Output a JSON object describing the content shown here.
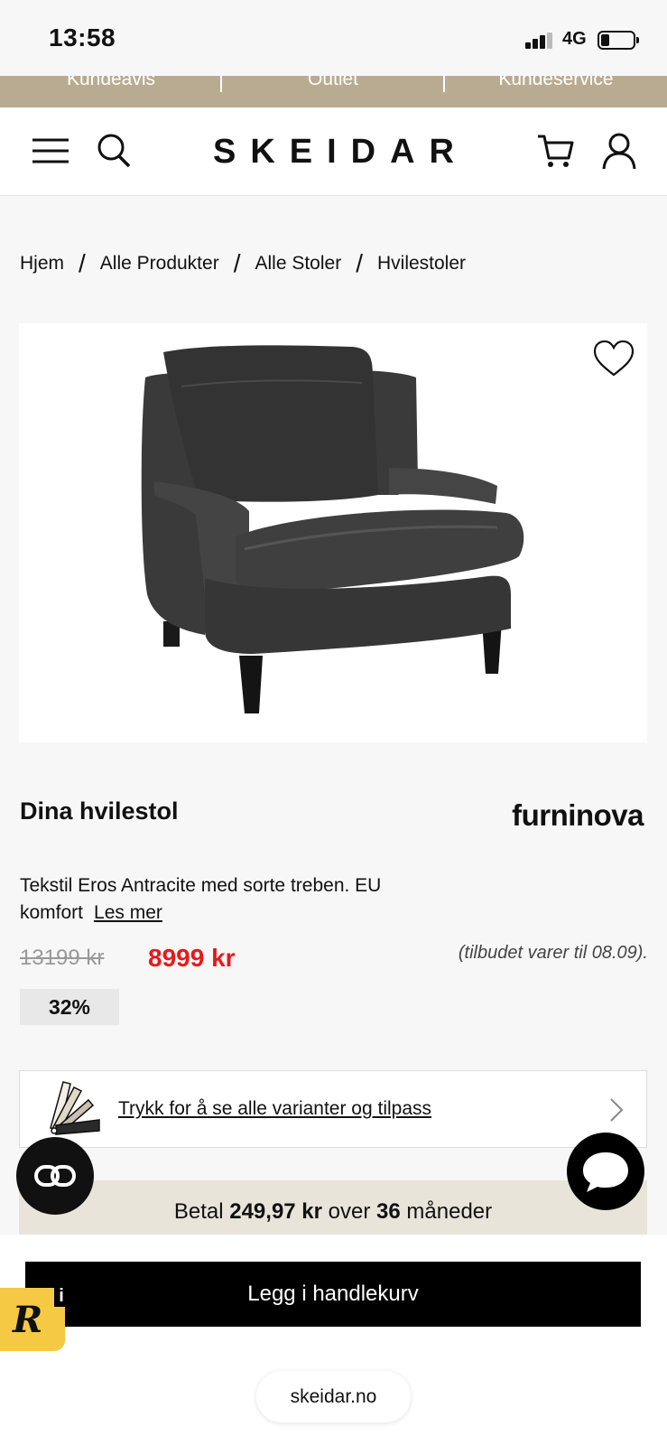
{
  "status": {
    "time": "13:58",
    "network": "4G"
  },
  "topbar": {
    "items": [
      "Kundeavis",
      "Outlet",
      "Kundeservice"
    ]
  },
  "header": {
    "logo": "SKEIDAR",
    "icons": [
      "menu-icon",
      "search-icon",
      "cart-icon",
      "user-icon"
    ]
  },
  "breadcrumb": [
    "Hjem",
    "Alle Produkter",
    "Alle Stoler",
    "Hvilestoler"
  ],
  "product": {
    "title": "Dina hvilestol",
    "brand": "furninova",
    "description": "Tekstil Eros Antracite med sorte treben. EU komfort",
    "read_more": "Les mer",
    "old_price": "13199 kr",
    "new_price": "8999 kr",
    "offer_note": "(tilbudet varer til 08.09).",
    "discount": "32%",
    "variants_label": "Trykk for å se alle varianter og tilpass"
  },
  "payment": {
    "prefix": "Betal",
    "amount": "249,97 kr",
    "middle": "over",
    "months": "36",
    "suffix": "måneder"
  },
  "cart": {
    "button": "Legg i handlekurv"
  },
  "browser": {
    "url": "skeidar.no"
  },
  "colors": {
    "accent_strip": "#b9ab91",
    "sale_red": "#e31b1b",
    "pay_bar": "#e9e4da",
    "badge_yellow": "#f5c944"
  }
}
